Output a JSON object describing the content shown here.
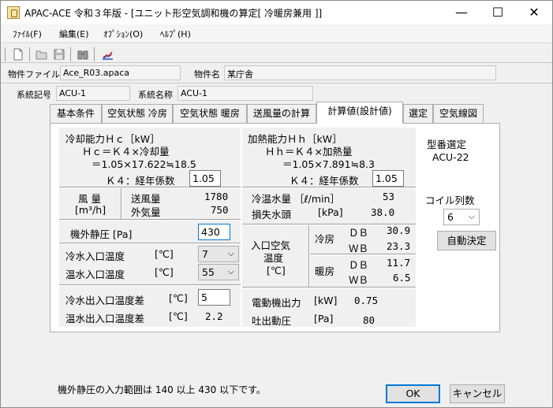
{
  "window": {
    "title": "APAC-ACE 令和３年版 - [ユニット形空気調和機の算定[ 冷暖房兼用 ]]",
    "minimize": "—",
    "maximize": "☐",
    "close": "✕"
  },
  "menu": [
    "ﾌｧｲﾙ(F)",
    "編集(E)",
    "ｵﾌﾟｼｮﾝ(O)",
    "ﾍﾙﾌﾟ(H)"
  ],
  "toolbar_icons": [
    "new-file-icon",
    "open-folder-icon",
    "save-icon",
    "binoculars-icon",
    "chart-icon"
  ],
  "info": {
    "file_label": "物件ファイル名",
    "file_value": "Ace_R03.apaca",
    "name_label": "物件名",
    "name_value": "某庁舎"
  },
  "system": {
    "code_label": "系統記号",
    "code_value": "ACU-1",
    "name_label": "系統名称",
    "name_value": "ACU-1"
  },
  "tabs": [
    "基本条件",
    "空気状態 冷房",
    "空気状態 暖房",
    "送風量の計算",
    "計算値(設計値)",
    "選定",
    "空気線図"
  ],
  "active_tab_index": 4,
  "cooling": {
    "title": "冷却能力Ｈｃ［kW］",
    "formula": "Ｈｃ＝Ｋ４×冷却量",
    "calc": "＝1.05×17.622≒18.5",
    "k4_label": "Ｋ４：経年係数",
    "k4_value": "1.05"
  },
  "heating": {
    "title": "加熱能力Ｈｈ［kW］",
    "formula": "Ｈｈ＝Ｋ４×加熱量",
    "calc": "＝1.05×7.891≒8.3",
    "k4_label": "Ｋ４：経年係数",
    "k4_value": "1.05"
  },
  "airflow": {
    "label_top": "風 量",
    "label_unit": "[m³/h]",
    "supply_label": "送風量",
    "supply_value": "1780",
    "outdoor_label": "外気量",
    "outdoor_value": "750"
  },
  "water": {
    "flow_label": "冷温水量 ［ℓ/min］",
    "flow_value": "53",
    "head_label": "損失水頭",
    "head_unit": "[kPa]",
    "head_value": "38.0"
  },
  "static_pressure": {
    "label": "機外静圧 [Pa]",
    "value": "430"
  },
  "inlet_temps": {
    "cold_label": "冷水入口温度",
    "cold_unit": "[℃]",
    "cold_value": "7",
    "hot_label": "温水入口温度",
    "hot_unit": "[℃]",
    "hot_value": "55"
  },
  "inlet_air": {
    "label_1": "入口空気",
    "label_2": "温度",
    "unit": "[℃]",
    "cool_label": "冷房",
    "heat_label": "暖房",
    "db_label": "ＤＢ",
    "wb_label": "ＷＢ",
    "cool_db": "30.9",
    "cool_wb": "23.3",
    "heat_db": "11.7",
    "heat_wb": "6.5"
  },
  "outlet_diff": {
    "cold_label": "冷水出入口温度差",
    "cold_unit": "[℃]",
    "cold_value": "5",
    "hot_label": "温水出入口温度差",
    "hot_unit": "[℃]",
    "hot_value": "2.2"
  },
  "motor": {
    "power_label": "電動機出力",
    "power_unit": "[kW]",
    "power_value": "0.75",
    "pressure_label": "吐出動圧",
    "pressure_unit": "[Pa]",
    "pressure_value": "80"
  },
  "model": {
    "label": "型番選定",
    "value": "ACU-22",
    "coil_label": "コイル列数",
    "coil_value": "6",
    "auto_button": "自動決定"
  },
  "status": "機外静圧の入力範囲は 140 以上 430 以下です。",
  "buttons": {
    "ok": "OK",
    "cancel": "キャンセル"
  }
}
